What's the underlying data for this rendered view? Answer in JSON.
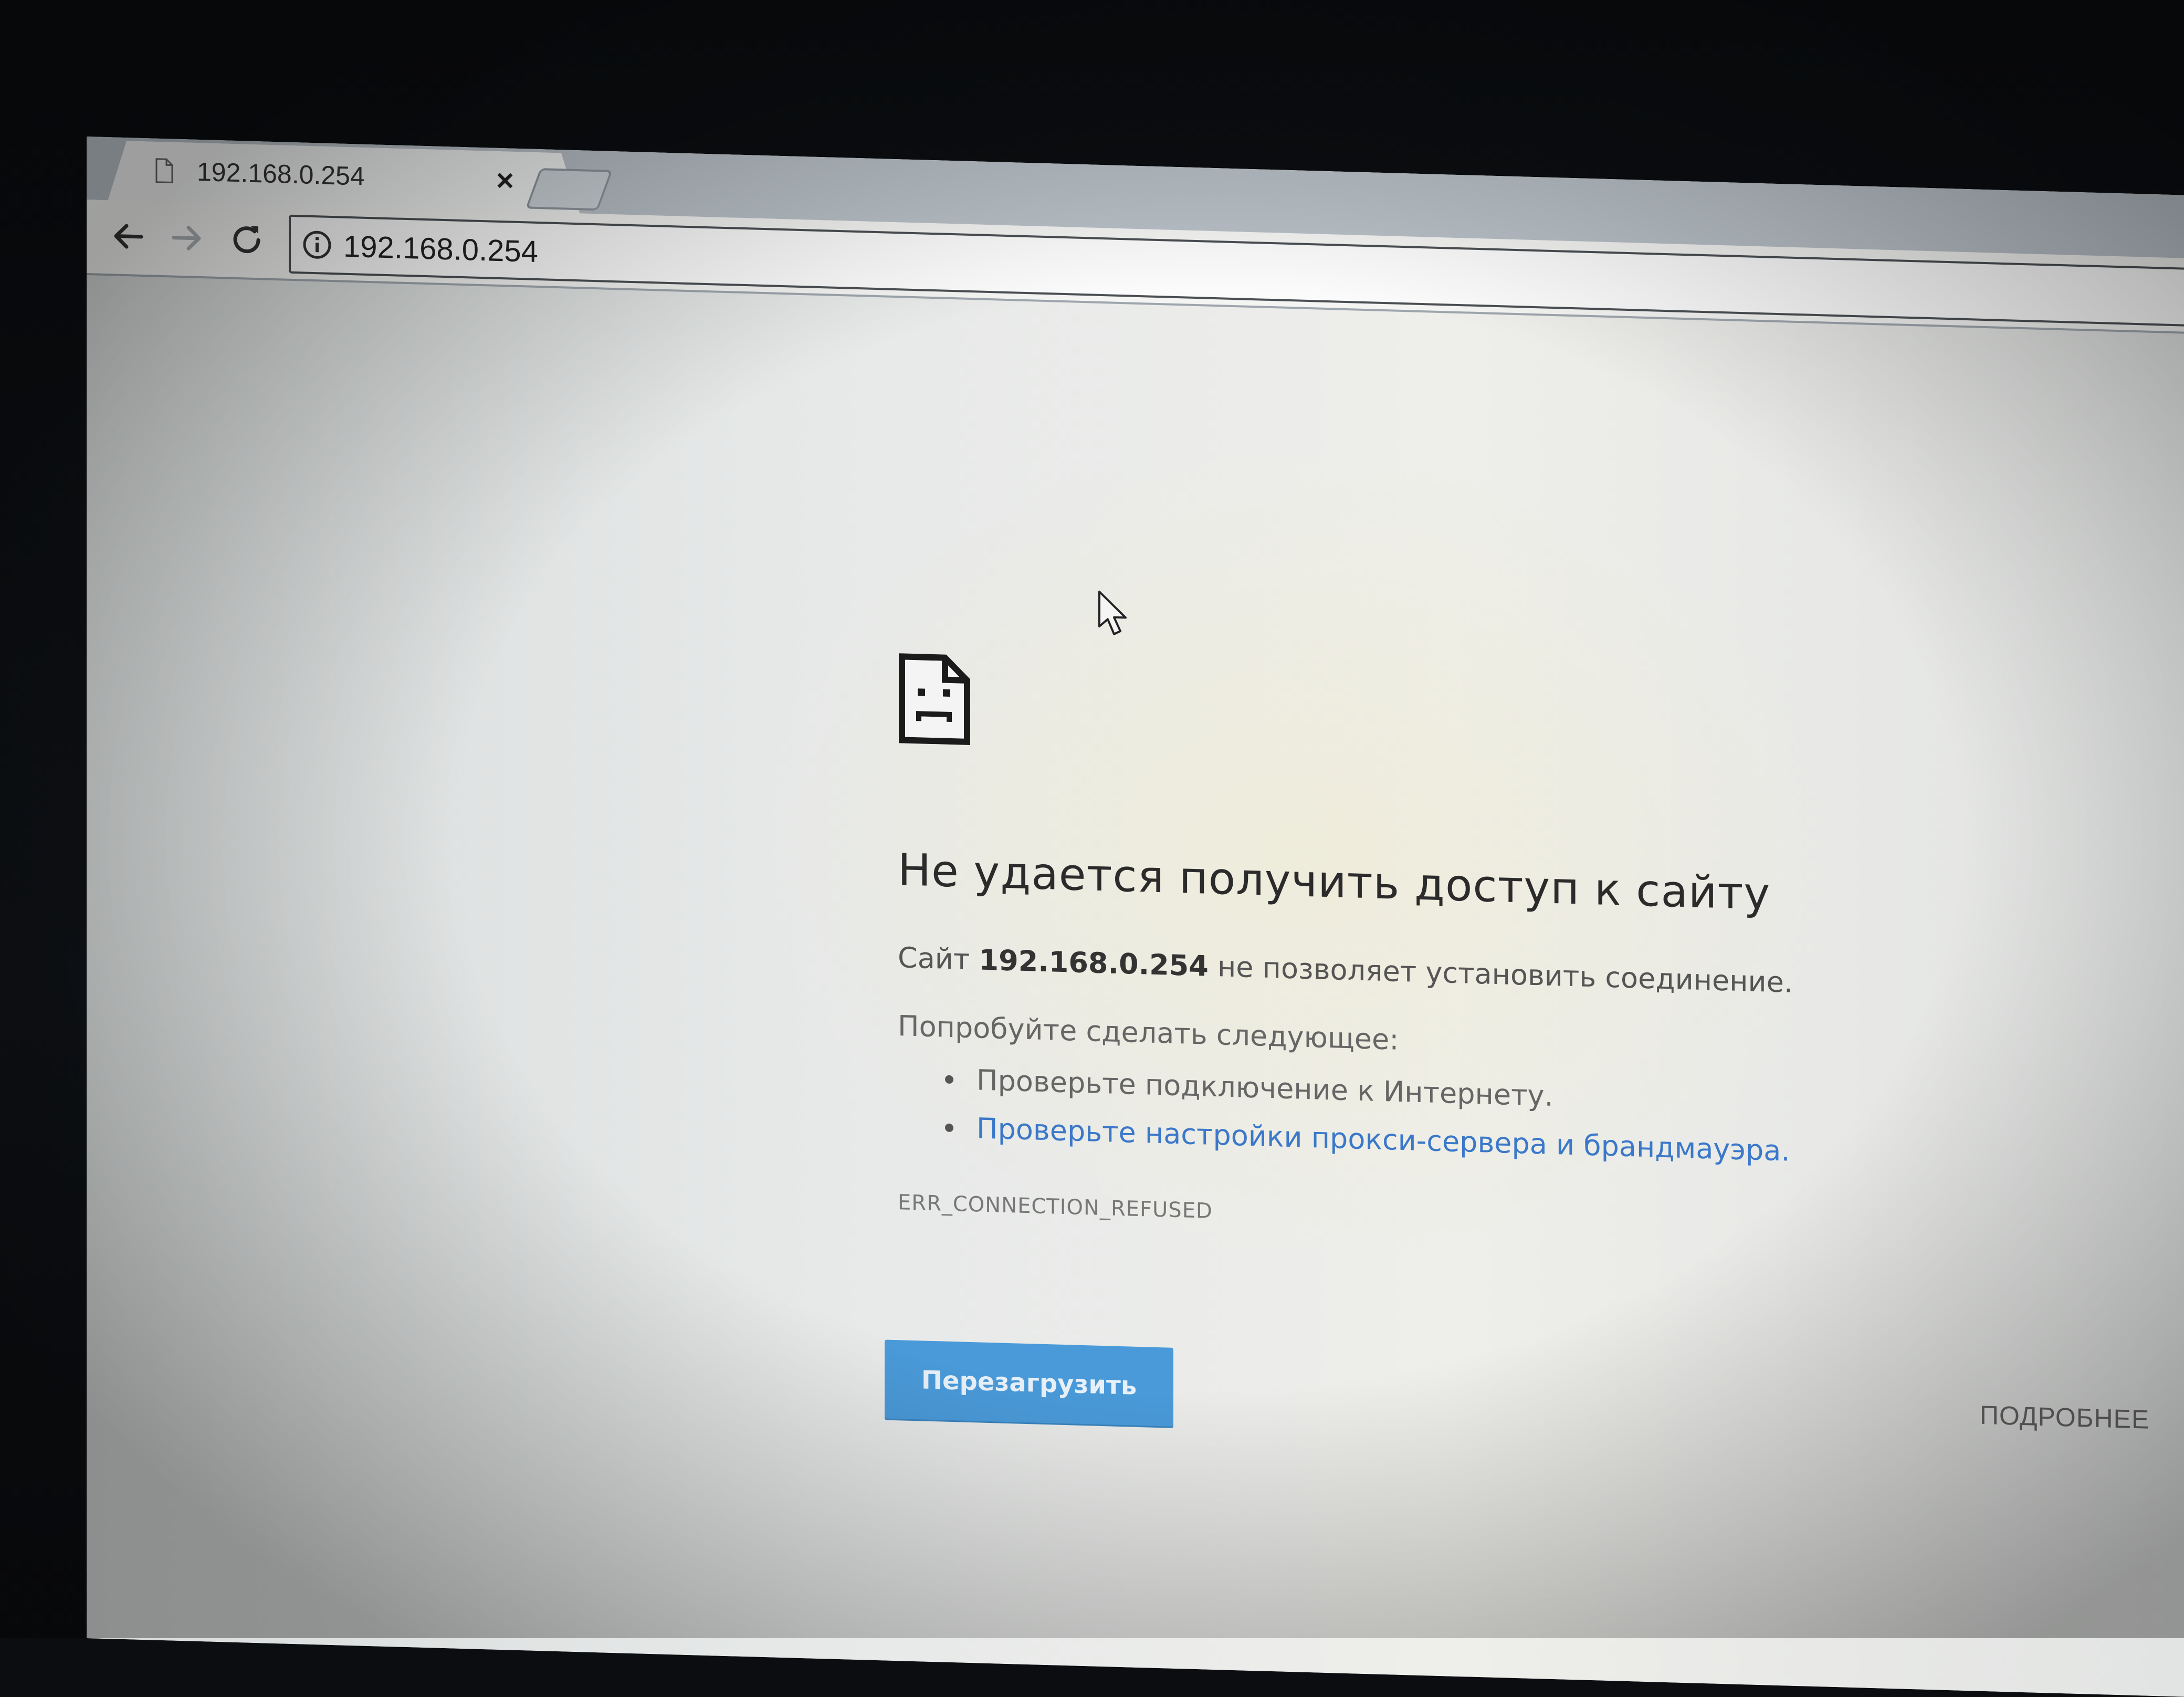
{
  "tab": {
    "title": "192.168.0.254",
    "close": "×"
  },
  "toolbar": {
    "url": "192.168.0.254"
  },
  "error": {
    "title": "Не удается получить доступ к сайту",
    "desc_prefix": "Сайт",
    "desc_host": "192.168.0.254",
    "desc_suffix": "не позволяет установить соединение.",
    "try_label": "Попробуйте сделать следующее:",
    "suggestions": [
      {
        "text": "Проверьте подключение к Интернету.",
        "link": false
      },
      {
        "text": "Проверьте настройки прокси-сервера и брандмауэра.",
        "link": true
      }
    ],
    "code": "ERR_CONNECTION_REFUSED"
  },
  "buttons": {
    "reload": "Перезагрузить",
    "details": "ПОДРОБНЕЕ"
  },
  "colors": {
    "button": "#4a9ad9",
    "link": "#3b78c9"
  }
}
